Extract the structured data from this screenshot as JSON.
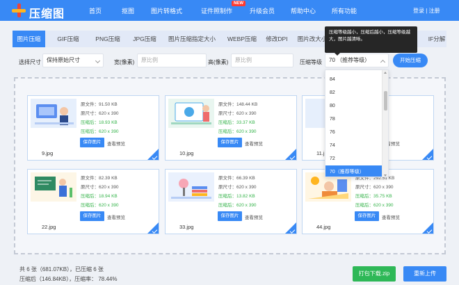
{
  "header": {
    "brand": "压缩图",
    "nav": [
      "首页",
      "抠图",
      "图片转格式",
      "证件照制作",
      "升级会员",
      "帮助中心",
      "所有功能"
    ],
    "new_badge": "NEW",
    "login": "登录 | 注册"
  },
  "tabs": [
    "图片压缩",
    "GIF压缩",
    "PNG压缩",
    "JPG压缩",
    "图片压缩指定大小",
    "WEBP压缩",
    "修改DPI",
    "图片改大小",
    "IF分解"
  ],
  "form": {
    "size_label": "选择尺寸",
    "size_value": "保持原始尺寸",
    "width_label": "宽(像素)",
    "width_placeholder": "原比例",
    "height_label": "高(像素)",
    "height_placeholder": "原比例",
    "level_label": "压缩等级",
    "level_value": "70 （推荐等级）",
    "start_button": "开始压缩"
  },
  "tooltip": "压缩等级越小，压缩后越小，压缩等级越大，图片越清晰。",
  "dropdown": {
    "options": [
      "84",
      "82",
      "80",
      "78",
      "76",
      "74",
      "72",
      "70（推荐等级）"
    ],
    "selected": "70（推荐等级）"
  },
  "card_labels": {
    "orig_file": "原文件：",
    "orig_size": "原尺寸：",
    "comp_file": "压缩后：",
    "comp_size": "压缩后：",
    "save": "保存图片",
    "preview": "查看预览"
  },
  "cards": [
    {
      "name": "9.jpg",
      "orig_file": "91.50 KB",
      "orig_size": "620 x 390",
      "comp_file": "18.93 KB",
      "comp_size": "620 x 390"
    },
    {
      "name": "10.jpg",
      "orig_file": "148.44 KB",
      "orig_size": "620 x 390",
      "comp_file": "33.37 KB",
      "comp_size": "620 x 390"
    },
    {
      "name": "11.jpg",
      "orig_file": "",
      "orig_size": "",
      "comp_file": "",
      "comp_size": ""
    },
    {
      "name": "22.jpg",
      "orig_file": "82.39 KB",
      "orig_size": "620 x 390",
      "comp_file": "18.94 KB",
      "comp_size": "620 x 390"
    },
    {
      "name": "33.jpg",
      "orig_file": "66.39 KB",
      "orig_size": "620 x 390",
      "comp_file": "13.82 KB",
      "comp_size": "620 x 390"
    },
    {
      "name": "44.jpg",
      "orig_file": "292.51 KB",
      "orig_size": "620 x 390",
      "comp_file": "35.75 KB",
      "comp_size": "620 x 390"
    }
  ],
  "footer": {
    "line1": "共 6 张（681.07KB），已压缩 6 张",
    "line2": "压缩后（146.84KB），压缩率： 78.44%",
    "zip_button": "打包下载.zip",
    "reupload_button": "重新上传"
  },
  "colors": {
    "primary": "#3889f5",
    "green": "#2eb857",
    "saved_text": "#35b34a"
  }
}
